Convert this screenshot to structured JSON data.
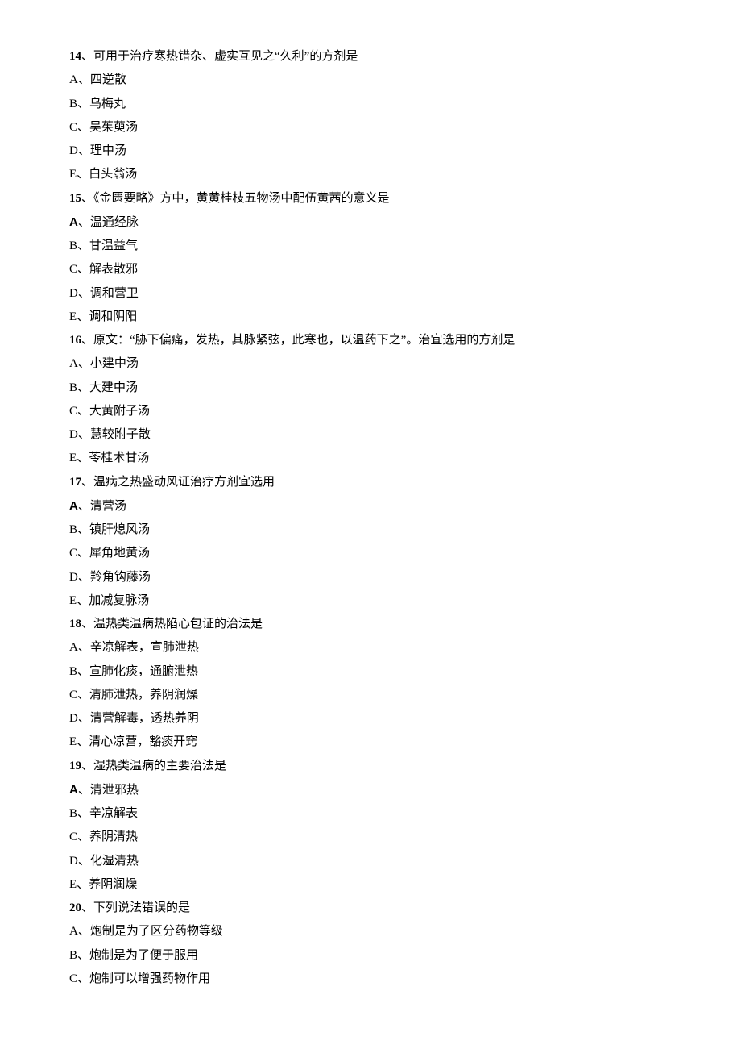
{
  "questions": [
    {
      "num": "14",
      "sep": "、",
      "stem": "可用于治疗寒热错杂、虚实互见之“久利”的方剂是",
      "options": [
        {
          "letter": "A",
          "text": "四逆散"
        },
        {
          "letter": "B",
          "text": "乌梅丸"
        },
        {
          "letter": "C",
          "text": "吴茱萸汤"
        },
        {
          "letter": "D",
          "text": "理中汤"
        },
        {
          "letter": "E",
          "text": "白头翁汤"
        }
      ]
    },
    {
      "num": "15",
      "sep": "、",
      "stem": "《金匮要略》方中，黄黄桂枝五物汤中配伍黄茜的意义是",
      "options": [
        {
          "letter": "A",
          "sans": true,
          "text": "温通经脉"
        },
        {
          "letter": "B",
          "text": "甘温益气"
        },
        {
          "letter": "C",
          "text": "解表散邪"
        },
        {
          "letter": "D",
          "text": "调和营卫"
        },
        {
          "letter": "E",
          "text": "调和阴阳"
        }
      ]
    },
    {
      "num": "16",
      "sep": "、",
      "stem": "原文：“胁下偏痛，发热，其脉紧弦，此寒也，以温药下之”。治宜选用的方剂是",
      "options": [
        {
          "letter": "A",
          "text": "小建中汤"
        },
        {
          "letter": "B",
          "text": "大建中汤"
        },
        {
          "letter": "C",
          "text": "大黄附子汤"
        },
        {
          "letter": "D",
          "text": "慧较附子散"
        },
        {
          "letter": "E",
          "text": "苓桂术甘汤"
        }
      ]
    },
    {
      "num": "17",
      "sep": "、",
      "stem": "温病之热盛动风证治疗方剂宜选用",
      "options": [
        {
          "letter": "A",
          "sans": true,
          "text": "清营汤"
        },
        {
          "letter": "B",
          "text": "镇肝熄风汤"
        },
        {
          "letter": "C",
          "text": "犀角地黄汤"
        },
        {
          "letter": "D",
          "text": "羚角钩藤汤"
        },
        {
          "letter": "E",
          "text": "加减复脉汤"
        }
      ]
    },
    {
      "num": "18",
      "sep": "、",
      "stem": "温热类温病热陷心包证的治法是",
      "options": [
        {
          "letter": "A",
          "text": "辛凉解表，宣肺泄热"
        },
        {
          "letter": "B",
          "text": "宣肺化痰，通腑泄热"
        },
        {
          "letter": "C",
          "text": "清肺泄热，养阴润燥"
        },
        {
          "letter": "D",
          "text": "清营解毒，透热养阴"
        },
        {
          "letter": "E",
          "text": "清心凉营，豁痰开窍"
        }
      ]
    },
    {
      "num": "19",
      "sep": "、",
      "stem": "湿热类温病的主要治法是",
      "options": [
        {
          "letter": "A",
          "sans": true,
          "text": "清泄邪热"
        },
        {
          "letter": "B",
          "text": "辛凉解表"
        },
        {
          "letter": "C",
          "text": "养阴清热"
        },
        {
          "letter": "D",
          "text": "化湿清热"
        },
        {
          "letter": "E",
          "text": "养阴润燥"
        }
      ]
    },
    {
      "num": "20",
      "sep": "、",
      "stem": "下列说法错误的是",
      "options": [
        {
          "letter": "A",
          "text": "炮制是为了区分药物等级"
        },
        {
          "letter": "B",
          "text": "炮制是为了便于服用"
        },
        {
          "letter": "C",
          "text": "炮制可以增强药物作用"
        }
      ]
    }
  ]
}
